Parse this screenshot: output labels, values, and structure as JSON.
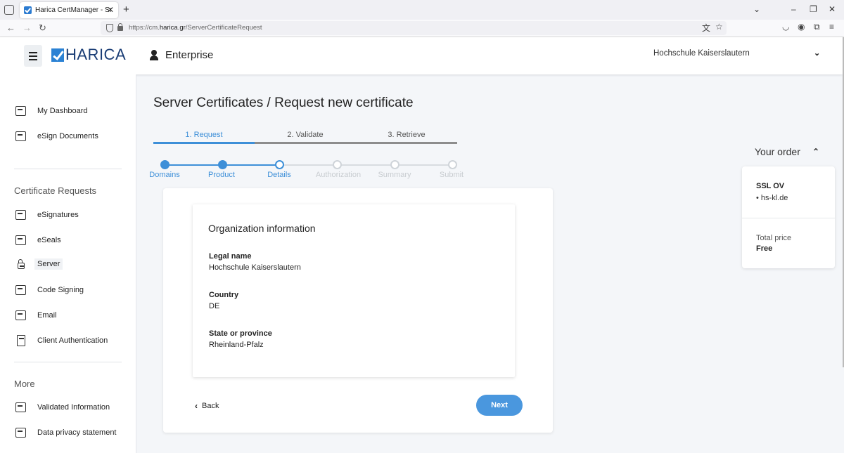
{
  "browser": {
    "tab_title": "Harica CertManager - Server Ce",
    "tab_close": "✕",
    "new_tab": "+",
    "url_prefix": "https://cm.",
    "url_domain": "harica.gr",
    "url_path": "/ServerCertificateRequest"
  },
  "header": {
    "logo_text": "HARICA",
    "workspace": "Enterprise",
    "organization": "Hochschule Kaiserslautern"
  },
  "sidebar": {
    "top_items": [
      {
        "label": "My Dashboard",
        "icon": "dashboard-icon"
      },
      {
        "label": "eSign Documents",
        "icon": "esign-icon"
      }
    ],
    "section_requests": "Certificate Requests",
    "request_items": [
      {
        "label": "eSignatures",
        "icon": "esign-icon"
      },
      {
        "label": "eSeals",
        "icon": "seal-icon"
      },
      {
        "label": "Server",
        "icon": "lock-icon"
      },
      {
        "label": "Code Signing",
        "icon": "code-icon"
      },
      {
        "label": "Email",
        "icon": "email-icon"
      },
      {
        "label": "Client Authentication",
        "icon": "document-icon"
      }
    ],
    "section_more": "More",
    "more_items": [
      {
        "label": "Validated Information",
        "icon": "validated-icon"
      },
      {
        "label": "Data privacy statement",
        "icon": "privacy-icon"
      }
    ]
  },
  "main": {
    "title": "Server Certificates / Request new certificate",
    "wizard": [
      "1. Request",
      "2. Validate",
      "3. Retrieve"
    ],
    "steps": [
      "Domains",
      "Product",
      "Details",
      "Authorization",
      "Summary",
      "Submit"
    ],
    "card": {
      "title": "Organization information",
      "fields": [
        {
          "label": "Legal name",
          "value": "Hochschule Kaiserslautern"
        },
        {
          "label": "Country",
          "value": "DE"
        },
        {
          "label": "State or province",
          "value": "Rheinland-Pfalz"
        }
      ],
      "back_label": "Back",
      "next_label": "Next"
    }
  },
  "order": {
    "heading": "Your order",
    "product": "SSL OV",
    "domain": "• hs-kl.de",
    "price_label": "Total price",
    "price": "Free"
  },
  "colors": {
    "accent": "#3d8fd8",
    "brand": "#1a3d75",
    "inactive": "#c8ccd0"
  }
}
